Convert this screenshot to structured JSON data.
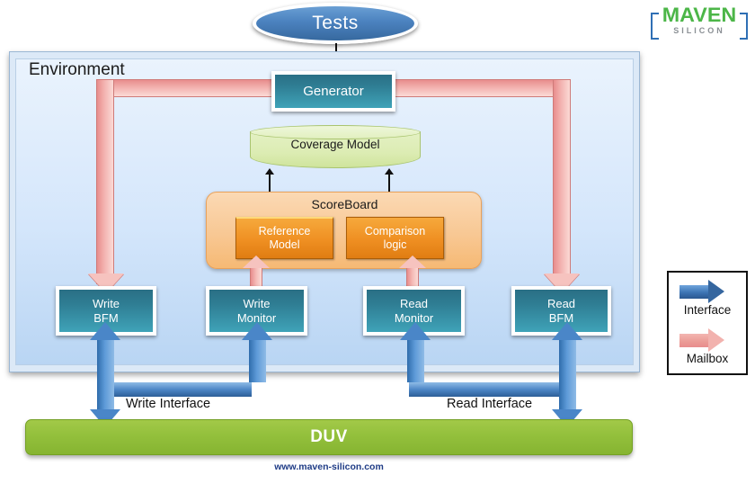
{
  "logo": {
    "brand": "MAVEN",
    "sub": "SILICON"
  },
  "top": {
    "tests_label": "Tests"
  },
  "environment": {
    "label": "Environment",
    "generator_label": "Generator",
    "coverage_label": "Coverage Model",
    "scoreboard": {
      "title": "ScoreBoard",
      "reference_model": "Reference\nModel",
      "reference_model_line1": "Reference",
      "reference_model_line2": "Model",
      "comparison_logic_line1": "Comparison",
      "comparison_logic_line2": "logic"
    },
    "agents": [
      {
        "line1": "Write",
        "line2": "BFM"
      },
      {
        "line1": "Write",
        "line2": "Monitor"
      },
      {
        "line1": "Read",
        "line2": "Monitor"
      },
      {
        "line1": "Read",
        "line2": "BFM"
      }
    ]
  },
  "interfaces": {
    "write_label": "Write Interface",
    "read_label": "Read Interface"
  },
  "duv": {
    "label": "DUV"
  },
  "footer": {
    "url": "www.maven-silicon.com"
  },
  "legend": {
    "interface_label": "Interface",
    "mailbox_label": "Mailbox"
  },
  "colors": {
    "teal_box": "#2f7e94",
    "green_duv": "#93c03c",
    "coverage_green": "#dcecb3",
    "scoreboard_orange": "#f8c894",
    "inner_orange": "#ef8f22",
    "mailbox_pink": "#f3b3b0",
    "interface_blue": "#3c74b4",
    "env_blue": "#d4e6fb",
    "tests_blue": "#4b82bf",
    "brand_green": "#4cb648",
    "footer_blue": "#1f3c86"
  }
}
